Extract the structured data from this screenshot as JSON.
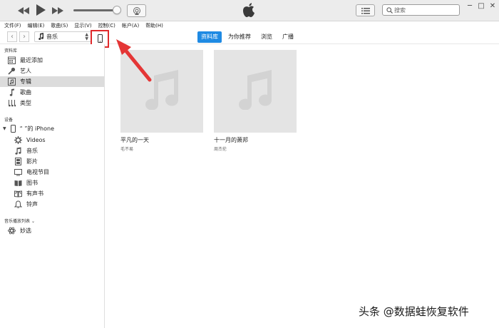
{
  "toolbar": {
    "prev_icon": "rewind-icon",
    "play_icon": "play-icon",
    "next_icon": "fast-forward-icon",
    "volume_level": 0.88,
    "airplay_icon": "airplay-icon",
    "logo_icon": "apple-logo-icon",
    "list_view_icon": "list-icon"
  },
  "search": {
    "placeholder": "搜索"
  },
  "window_controls": {
    "minimize": "─",
    "maximize": "□",
    "close": "✕"
  },
  "menu": [
    "文件(F)",
    "编辑(E)",
    "歌曲(S)",
    "显示(V)",
    "控制(C)",
    "帐户(A)",
    "帮助(H)"
  ],
  "nav": {
    "back": "‹",
    "forward": "›",
    "media_type": "音乐",
    "media_icon": "music-note-icon",
    "device_icon": "iphone-icon"
  },
  "tabs": [
    {
      "label": "资料库",
      "active": true
    },
    {
      "label": "为你推荐",
      "active": false
    },
    {
      "label": "浏览",
      "active": false
    },
    {
      "label": "广播",
      "active": false
    }
  ],
  "sidebar": {
    "library_title": "资料库",
    "library_items": [
      {
        "label": "最近添加",
        "icon": "calendar-icon"
      },
      {
        "label": "艺人",
        "icon": "microphone-icon"
      },
      {
        "label": "专辑",
        "icon": "album-icon",
        "selected": true
      },
      {
        "label": "歌曲",
        "icon": "music-note-icon"
      },
      {
        "label": "类型",
        "icon": "genre-icon"
      }
    ],
    "devices_title": "设备",
    "device_name": "“      ”的 iPhone",
    "device_items": [
      {
        "label": "Videos",
        "icon": "gear-icon"
      },
      {
        "label": "音乐",
        "icon": "music-note-icon"
      },
      {
        "label": "影片",
        "icon": "film-icon"
      },
      {
        "label": "电视节目",
        "icon": "tv-icon"
      },
      {
        "label": "图书",
        "icon": "book-icon"
      },
      {
        "label": "有声书",
        "icon": "audiobook-icon"
      },
      {
        "label": "铃声",
        "icon": "bell-icon"
      }
    ],
    "playlists_title": "音乐播放列表",
    "playlist_items": [
      {
        "label": "妙选",
        "icon": "genius-icon"
      }
    ]
  },
  "albums": [
    {
      "title": "平凡的一天",
      "artist": "毛不易"
    },
    {
      "title": "十一月的萧邦",
      "artist": "周杰伦"
    }
  ],
  "watermark": "头条 @数据蛙恢复软件",
  "colors": {
    "accent": "#1f8ae3",
    "highlight": "#e0292b",
    "selected_row": "#dcdcdc",
    "artwork_bg": "#e4e4e4"
  }
}
